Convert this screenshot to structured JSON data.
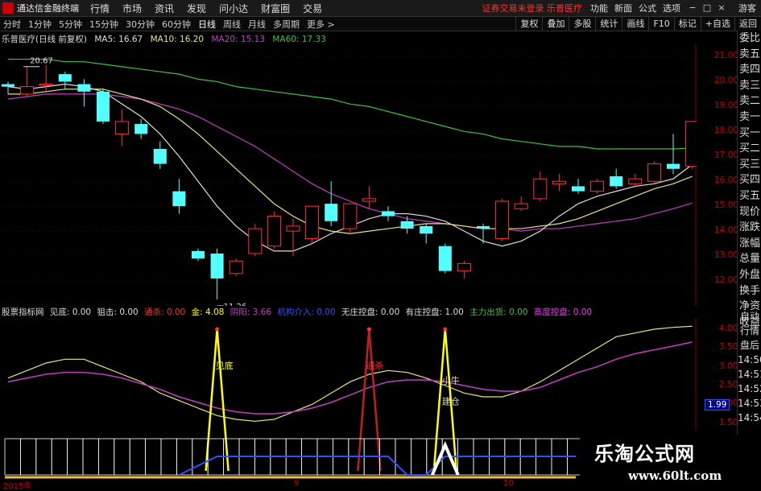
{
  "app": {
    "title": "通达信金融终端"
  },
  "menu": [
    "行情",
    "市场",
    "资讯",
    "发现",
    "问小达",
    "财富圈",
    "交易"
  ],
  "top_status": "证券交易未登录  乐普医疗",
  "top_right": [
    "功能",
    "新面",
    "公式",
    "选项"
  ],
  "guest": "游客",
  "periods": [
    "分时",
    "1分钟",
    "5分钟",
    "15分钟",
    "30分钟",
    "60分钟",
    "日线",
    "周线",
    "月线",
    "多周期",
    "更多 >"
  ],
  "tools": [
    "复权",
    "叠加",
    "多股",
    "统计",
    "画线",
    "F10",
    "标记",
    "+自选",
    "返回"
  ],
  "legend": {
    "stock": "乐普医疗(日线 前复权)",
    "ma5": "MA5: 16.67",
    "ma10": "MA10: 16.20",
    "ma20": "MA20: 15.13",
    "ma60": "MA60: 17.33"
  },
  "price_labels": {
    "high": "20.67",
    "low": "11.26"
  },
  "y_ticks": [
    "21.00",
    "20.00",
    "19.00",
    "18.00",
    "17.00",
    "16.00",
    "15.00",
    "14.00",
    "13.00",
    "12.00"
  ],
  "right_panel": [
    "委比",
    "卖五",
    "卖四",
    "卖三",
    "卖二",
    "卖一",
    "买一",
    "买二",
    "买三",
    "买四",
    "买五",
    "现价",
    "涨跌",
    "涨幅",
    "总量",
    "外盘",
    "换手",
    "净资",
    "收益"
  ],
  "right_panel2": [
    "自动",
    "行情",
    "盘后",
    "14:50",
    "14:51",
    "14:52",
    "14:53",
    "14:54"
  ],
  "ind_legend": {
    "name": "股票指标网",
    "jiandi": "见底: 0.00",
    "juji": "狙击: 0.00",
    "tongsha": "通杀: 0.00",
    "jin": "金: 4.08",
    "yangyang": "阴阳: 3.66",
    "zhuli": "机构介入: 0.00",
    "wuzhuang": "无庄控盘: 0.00",
    "youzhuang": "有庄控盘: 1.00",
    "zhulichu": "主力出货: 0.00",
    "gaodu": "高度控盘: 0.00"
  },
  "ind_y_ticks": [
    "4.00",
    "3.50",
    "3.00",
    "2.50",
    "2.00",
    "1.50"
  ],
  "ind_current": "1.99",
  "ind_labels": {
    "jiandi": "见底",
    "xiaoniu": "小牛",
    "jianli": "建仓",
    "tongsha": "通杀"
  },
  "x_labels": [
    "2015年",
    "9",
    "10"
  ],
  "watermark": {
    "title": "乐淘公式网",
    "url": "www.60lt.com"
  },
  "chart_data": {
    "type": "candlestick",
    "y_range": [
      11.0,
      21.5
    ],
    "candles": [
      {
        "o": 19.9,
        "c": 19.8,
        "h": 20.0,
        "l": 19.5,
        "up": false
      },
      {
        "o": 19.5,
        "c": 19.8,
        "h": 20.6,
        "l": 19.4,
        "up": true
      },
      {
        "o": 19.9,
        "c": 19.9,
        "h": 20.67,
        "l": 19.6,
        "up": true
      },
      {
        "o": 20.3,
        "c": 20.0,
        "h": 20.4,
        "l": 19.7,
        "up": false
      },
      {
        "o": 19.9,
        "c": 19.6,
        "h": 20.1,
        "l": 19.0,
        "up": false
      },
      {
        "o": 19.6,
        "c": 18.4,
        "h": 19.7,
        "l": 18.3,
        "up": false
      },
      {
        "o": 17.9,
        "c": 18.4,
        "h": 18.9,
        "l": 17.4,
        "up": true
      },
      {
        "o": 18.3,
        "c": 17.9,
        "h": 18.5,
        "l": 17.7,
        "up": false
      },
      {
        "o": 17.3,
        "c": 16.7,
        "h": 17.6,
        "l": 16.5,
        "up": false
      },
      {
        "o": 15.6,
        "c": 15.0,
        "h": 16.1,
        "l": 14.7,
        "up": false
      },
      {
        "o": 13.2,
        "c": 12.9,
        "h": 13.3,
        "l": 12.8,
        "up": false
      },
      {
        "o": 13.1,
        "c": 12.1,
        "h": 13.3,
        "l": 11.26,
        "up": false
      },
      {
        "o": 12.3,
        "c": 12.8,
        "h": 12.9,
        "l": 12.2,
        "up": true
      },
      {
        "o": 13.1,
        "c": 14.1,
        "h": 14.3,
        "l": 13.0,
        "up": true
      },
      {
        "o": 13.4,
        "c": 14.6,
        "h": 14.8,
        "l": 13.3,
        "up": true
      },
      {
        "o": 14.0,
        "c": 14.2,
        "h": 14.5,
        "l": 13.0,
        "up": true
      },
      {
        "o": 13.7,
        "c": 15.0,
        "h": 15.0,
        "l": 13.5,
        "up": true
      },
      {
        "o": 15.1,
        "c": 14.4,
        "h": 16.0,
        "l": 14.2,
        "up": false
      },
      {
        "o": 14.1,
        "c": 15.1,
        "h": 15.1,
        "l": 13.9,
        "up": true
      },
      {
        "o": 15.2,
        "c": 15.3,
        "h": 15.8,
        "l": 14.9,
        "up": true
      },
      {
        "o": 14.8,
        "c": 14.6,
        "h": 15.0,
        "l": 14.4,
        "up": false
      },
      {
        "o": 14.4,
        "c": 14.1,
        "h": 14.6,
        "l": 13.9,
        "up": false
      },
      {
        "o": 14.2,
        "c": 13.9,
        "h": 14.3,
        "l": 13.5,
        "up": false
      },
      {
        "o": 13.4,
        "c": 12.4,
        "h": 13.5,
        "l": 12.3,
        "up": false
      },
      {
        "o": 12.4,
        "c": 12.7,
        "h": 12.8,
        "l": 12.1,
        "up": true
      },
      {
        "o": 14.2,
        "c": 14.1,
        "h": 14.3,
        "l": 13.5,
        "up": false
      },
      {
        "o": 13.7,
        "c": 15.2,
        "h": 15.3,
        "l": 13.6,
        "up": true
      },
      {
        "o": 14.9,
        "c": 15.1,
        "h": 15.4,
        "l": 14.8,
        "up": true
      },
      {
        "o": 15.3,
        "c": 16.1,
        "h": 16.4,
        "l": 15.2,
        "up": true
      },
      {
        "o": 15.9,
        "c": 16.0,
        "h": 16.3,
        "l": 15.6,
        "up": true
      },
      {
        "o": 15.8,
        "c": 15.6,
        "h": 16.1,
        "l": 15.5,
        "up": false
      },
      {
        "o": 15.6,
        "c": 16.0,
        "h": 16.1,
        "l": 15.5,
        "up": true
      },
      {
        "o": 16.2,
        "c": 15.8,
        "h": 16.5,
        "l": 15.7,
        "up": false
      },
      {
        "o": 15.9,
        "c": 16.1,
        "h": 16.3,
        "l": 15.8,
        "up": true
      },
      {
        "o": 16.0,
        "c": 16.7,
        "h": 16.8,
        "l": 15.9,
        "up": true
      },
      {
        "o": 16.7,
        "c": 16.5,
        "h": 17.9,
        "l": 16.3,
        "up": false
      },
      {
        "o": 16.6,
        "c": 18.4,
        "h": 18.4,
        "l": 16.5,
        "up": true
      }
    ],
    "ma5": [
      19.8,
      19.7,
      19.8,
      19.9,
      19.8,
      19.6,
      19.1,
      18.6,
      17.9,
      17.0,
      16.0,
      15.0,
      14.2,
      13.6,
      13.2,
      13.2,
      13.5,
      13.9,
      14.2,
      14.5,
      14.7,
      14.7,
      14.6,
      14.4,
      14.0,
      13.6,
      13.4,
      13.6,
      14.0,
      14.6,
      15.1,
      15.4,
      15.6,
      15.8,
      15.9,
      16.1,
      16.67
    ],
    "ma10": [
      19.5,
      19.5,
      19.6,
      19.7,
      19.7,
      19.7,
      19.5,
      19.3,
      19.0,
      18.5,
      17.9,
      17.2,
      16.5,
      15.8,
      15.1,
      14.6,
      14.2,
      14.0,
      13.9,
      14.0,
      14.1,
      14.2,
      14.3,
      14.3,
      14.2,
      14.1,
      14.1,
      14.1,
      14.2,
      14.3,
      14.5,
      14.8,
      15.1,
      15.4,
      15.7,
      15.9,
      16.2
    ],
    "ma20": [
      19.3,
      19.4,
      19.5,
      19.5,
      19.5,
      19.5,
      19.4,
      19.3,
      19.1,
      18.9,
      18.6,
      18.2,
      17.8,
      17.4,
      16.9,
      16.4,
      15.9,
      15.5,
      15.2,
      14.9,
      14.7,
      14.5,
      14.4,
      14.3,
      14.2,
      14.1,
      14.1,
      14.0,
      14.1,
      14.1,
      14.2,
      14.3,
      14.4,
      14.5,
      14.7,
      14.9,
      15.13
    ],
    "ma60": [
      20.9,
      20.9,
      20.9,
      20.8,
      20.8,
      20.7,
      20.6,
      20.5,
      20.4,
      20.3,
      20.1,
      20.0,
      19.8,
      19.7,
      19.6,
      19.5,
      19.4,
      19.3,
      19.1,
      19.0,
      18.8,
      18.6,
      18.4,
      18.2,
      18.0,
      17.9,
      17.7,
      17.6,
      17.5,
      17.4,
      17.4,
      17.3,
      17.3,
      17.3,
      17.3,
      17.3,
      17.33
    ],
    "ind_range": [
      1.3,
      4.3
    ],
    "ind_yellow": [
      2.7,
      2.9,
      3.1,
      3.2,
      3.2,
      3.0,
      2.8,
      2.6,
      2.3,
      2.1,
      1.9,
      1.7,
      1.6,
      1.55,
      1.6,
      1.8,
      2.0,
      2.3,
      2.6,
      2.8,
      2.9,
      2.85,
      2.7,
      2.5,
      2.3,
      2.2,
      2.2,
      2.35,
      2.6,
      2.9,
      3.2,
      3.5,
      3.8,
      3.9,
      4.0,
      4.05,
      4.08
    ],
    "ind_purple": [
      2.6,
      2.7,
      2.8,
      2.85,
      2.85,
      2.8,
      2.7,
      2.55,
      2.4,
      2.2,
      2.05,
      1.9,
      1.8,
      1.75,
      1.75,
      1.8,
      1.9,
      2.05,
      2.25,
      2.45,
      2.6,
      2.65,
      2.65,
      2.6,
      2.5,
      2.4,
      2.35,
      2.35,
      2.45,
      2.65,
      2.85,
      3.0,
      3.2,
      3.35,
      3.45,
      3.55,
      3.66
    ]
  }
}
